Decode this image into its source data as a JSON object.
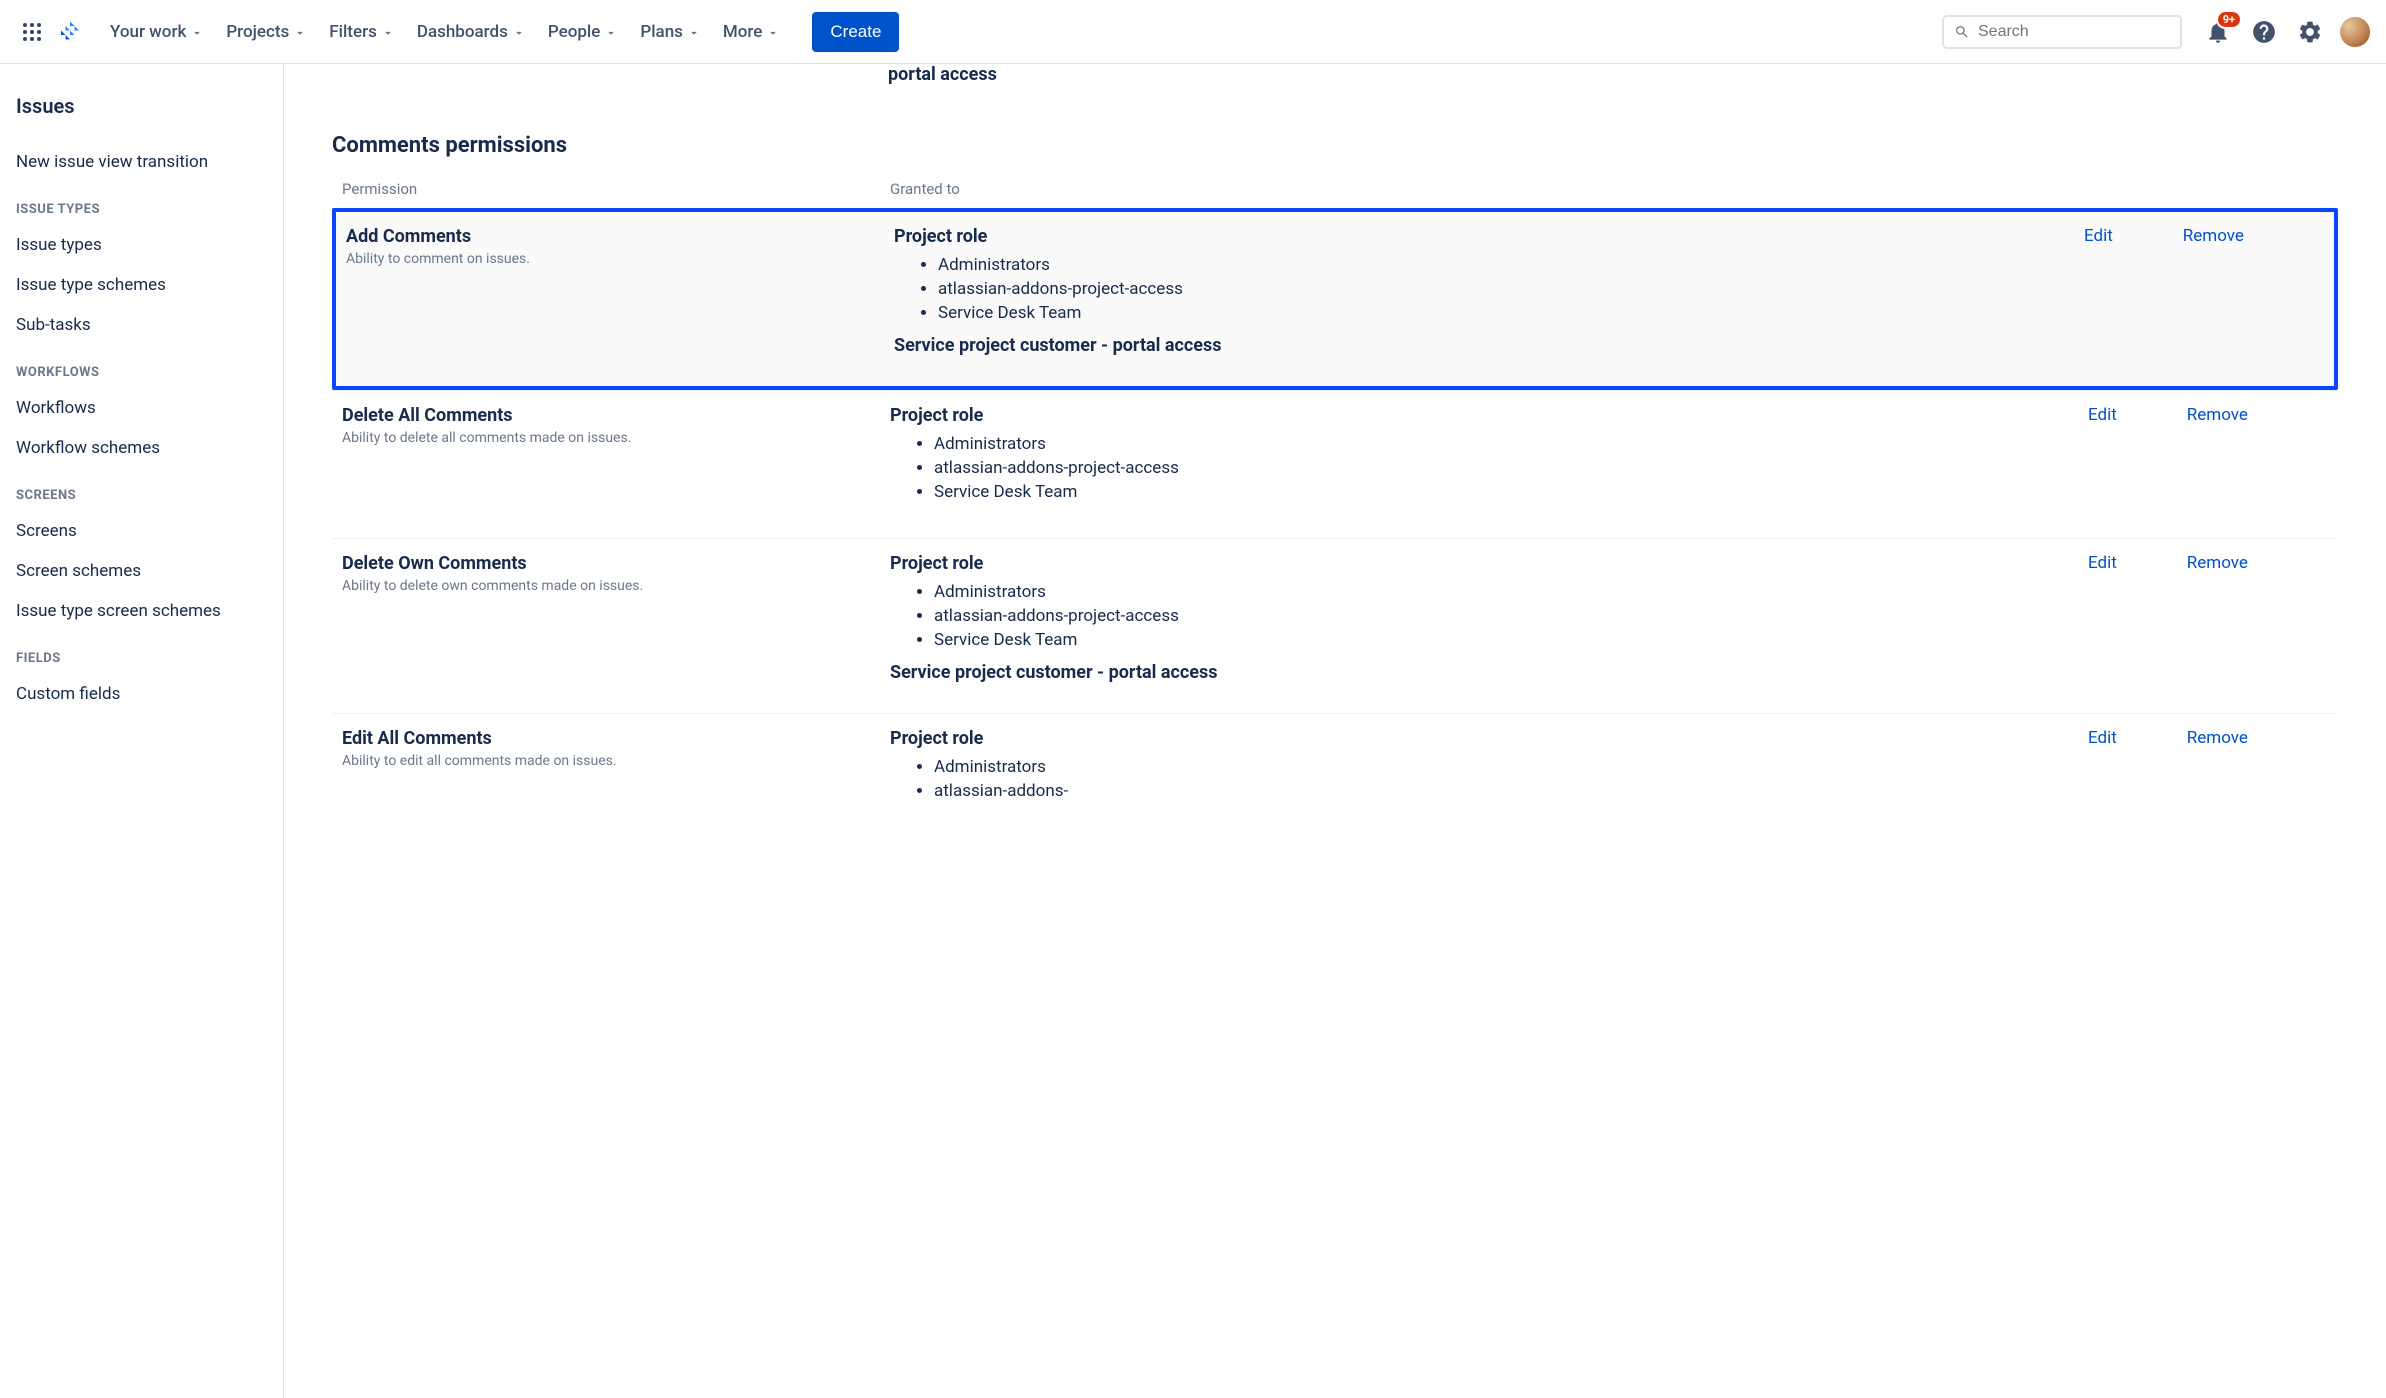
{
  "nav": {
    "items": [
      "Your work",
      "Projects",
      "Filters",
      "Dashboards",
      "People",
      "Plans",
      "More"
    ],
    "create": "Create",
    "search_placeholder": "Search",
    "notification_badge": "9+"
  },
  "sidebar": {
    "title": "Issues",
    "top_link": "New issue view transition",
    "groups": [
      {
        "label": "ISSUE TYPES",
        "items": [
          "Issue types",
          "Issue type schemes",
          "Sub-tasks"
        ]
      },
      {
        "label": "WORKFLOWS",
        "items": [
          "Workflows",
          "Workflow schemes"
        ]
      },
      {
        "label": "SCREENS",
        "items": [
          "Screens",
          "Screen schemes",
          "Issue type screen schemes"
        ]
      },
      {
        "label": "FIELDS",
        "items": [
          "Custom fields"
        ]
      }
    ]
  },
  "main": {
    "partial_top_text": "portal access",
    "section_title": "Comments permissions",
    "columns": {
      "permission": "Permission",
      "granted": "Granted to"
    },
    "actions": {
      "edit": "Edit",
      "remove": "Remove"
    },
    "grant_labels": {
      "project_role": "Project role",
      "service_customer": "Service project customer - portal access"
    },
    "roles": [
      "Administrators",
      "atlassian-addons-project-access",
      "Service Desk Team"
    ],
    "permissions": [
      {
        "name": "Add Comments",
        "desc": "Ability to comment on issues.",
        "highlighted": true,
        "show_service": true
      },
      {
        "name": "Delete All Comments",
        "desc": "Ability to delete all comments made on issues.",
        "highlighted": false,
        "show_service": false
      },
      {
        "name": "Delete Own Comments",
        "desc": "Ability to delete own comments made on issues.",
        "highlighted": false,
        "show_service": true
      },
      {
        "name": "Edit All Comments",
        "desc": "Ability to edit all comments made on issues.",
        "highlighted": false,
        "show_service": false,
        "partial": true
      }
    ],
    "partial_last_role": "atlassian-addons-"
  }
}
